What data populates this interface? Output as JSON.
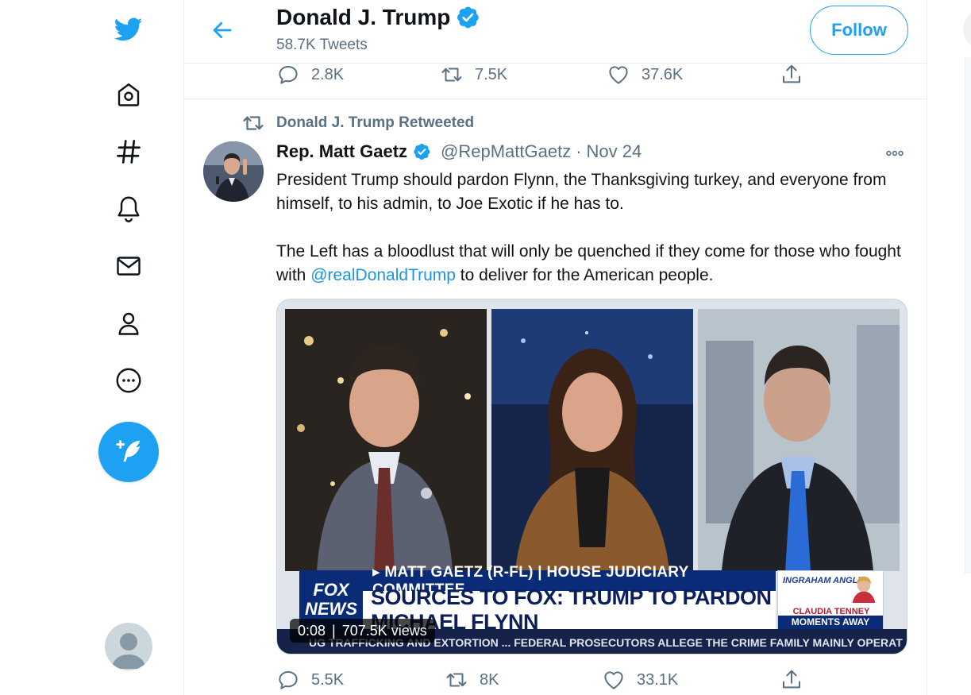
{
  "brand": {
    "logo_icon": "twitter-bird-icon",
    "accent": "#1da1f2"
  },
  "nav": {
    "items": [
      {
        "name": "home",
        "icon": "home-icon"
      },
      {
        "name": "explore",
        "icon": "hashtag-icon"
      },
      {
        "name": "notifications",
        "icon": "bell-icon"
      },
      {
        "name": "messages",
        "icon": "mail-icon"
      },
      {
        "name": "profile",
        "icon": "person-icon"
      },
      {
        "name": "more",
        "icon": "more-circle-icon"
      }
    ],
    "tweet_button_icon": "compose-quill-icon",
    "account_icon": "default-avatar-icon"
  },
  "header": {
    "name": "Donald J. Trump",
    "verified": true,
    "tweet_count": "58.7K Tweets",
    "follow_label": "Follow"
  },
  "prev_tweet_actions": {
    "replies": "2.8K",
    "retweets": "7.5K",
    "likes": "37.6K"
  },
  "tweet": {
    "retweeted_by": "Donald J. Trump Retweeted",
    "author_name": "Rep. Matt Gaetz",
    "verified": true,
    "handle": "@RepMattGaetz",
    "separator": "·",
    "date": "Nov 24",
    "body_p1": "President Trump should pardon Flynn, the Thanksgiving turkey, and everyone from himself, to his admin, to Joe Exotic if he has to.",
    "body_p2_pre": "The Left has a bloodlust that will only be quenched if they come for those who fought with ",
    "body_p2_mention": "@realDonaldTrump",
    "body_p2_post": " to deliver for the American people.",
    "media": {
      "chyron_top": "▸ MATT GAETZ (R-FL) | HOUSE JUDICIARY COMMITTEE",
      "chyron_main": "SOURCES TO FOX: TRUMP TO PARDON MICHAEL FLYNN",
      "network_line1": "FOX",
      "network_line2": "NEWS",
      "ticker": "UG TRAFFICKING AND EXTORTION ...   FEDERAL PROSECUTORS ALLEGE THE CRIME FAMILY MAINLY OPERAT",
      "show_logo": "INGRAHAM ANGLE",
      "guest_name": "CLAUDIA TENNEY",
      "segment": "MOMENTS AWAY",
      "duration": "0:08",
      "views": "707.5K views"
    },
    "actions": {
      "replies": "5.5K",
      "retweets": "8K",
      "likes": "33.1K"
    }
  }
}
